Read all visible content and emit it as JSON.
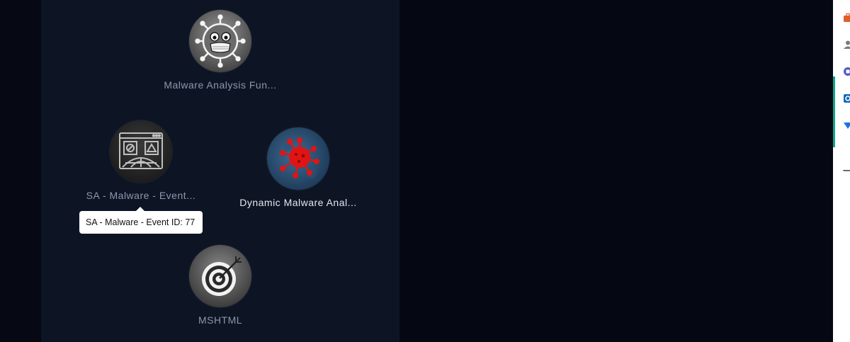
{
  "nodes": [
    {
      "label": "Malware Analysis Fun...",
      "icon": "virus-mask-icon"
    },
    {
      "label": "SA - Malware - Event...",
      "icon": "browser-globe-warning-icon"
    },
    {
      "label": "Dynamic Malware Anal...",
      "icon": "red-virus-icon"
    },
    {
      "label": "MSHTML",
      "icon": "target-arrow-icon"
    }
  ],
  "tooltip": {
    "text": "SA - Malware - Event ID: 77"
  },
  "sidebar": {
    "items": [
      {
        "icon": "briefcase-icon",
        "color": "#e25d2a"
      },
      {
        "icon": "person-icon",
        "color": "#7a7a7a"
      },
      {
        "icon": "teams-icon",
        "color": "#5059c9"
      },
      {
        "icon": "outlook-icon",
        "color": "#0f6cbd"
      },
      {
        "icon": "send-icon",
        "color": "#1a73e8"
      },
      {
        "icon": "add-icon",
        "color": "#555555"
      }
    ],
    "accent_color": "#14a38b"
  },
  "colors": {
    "background": "#060914",
    "panel": "#0d1525",
    "label_dim": "#8d97ab",
    "label_bright": "#e3e7ee"
  }
}
